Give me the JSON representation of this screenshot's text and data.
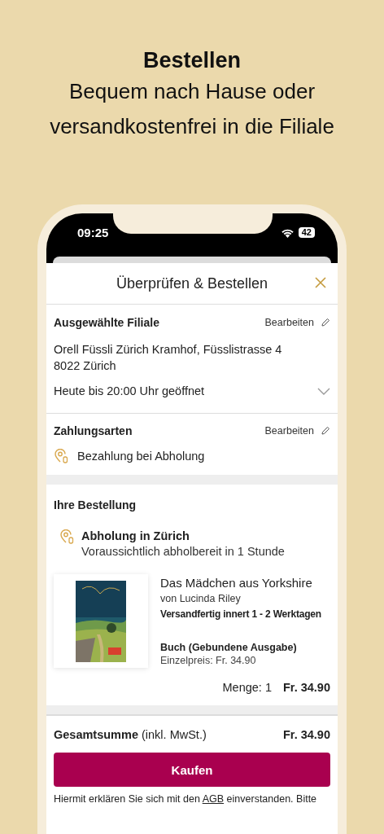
{
  "promo": {
    "title": "Bestellen",
    "subtitle_lines": [
      "Bequem nach Hause oder",
      "versandkostenfrei in die Filiale"
    ]
  },
  "status_bar": {
    "time": "09:25",
    "battery": "42"
  },
  "sheet": {
    "title": "Überprüfen & Bestellen"
  },
  "store": {
    "heading": "Ausgewählte Filiale",
    "edit": "Bearbeiten",
    "address_lines": [
      "Orell Füssli Zürich Kramhof, Füsslistrasse 4",
      "8022 Zürich"
    ],
    "hours": "Heute bis 20:00 Uhr geöffnet",
    "expanded": false
  },
  "payment": {
    "heading": "Zahlungsarten",
    "edit": "Bearbeiten",
    "method": "Bezahlung bei Abholung"
  },
  "order": {
    "heading": "Ihre Bestellung",
    "pickup_title": "Abholung in Zürich",
    "pickup_note": "Voraussichtlich abholbereit in 1 Stunde",
    "items": [
      {
        "title": "Das Mädchen aus Yorkshire",
        "author": "von Lucinda Riley",
        "availability": "Versandfertig innert 1 - 2 Werktagen",
        "format": "Buch (Gebundene Ausgabe)",
        "unit_price": "Einzelpreis: Fr. 34.90",
        "quantity": "Menge: 1",
        "price": "Fr. 34.90"
      }
    ]
  },
  "total": {
    "label": "**Gesamtsumme** (inkl. MwSt.)",
    "amount": "Fr. 34.90"
  },
  "buy_button": "Kaufen",
  "terms": {
    "before": "Hiermit erklären Sie sich mit den ",
    "link": "AGB",
    "after": " einverstanden. Bitte"
  }
}
